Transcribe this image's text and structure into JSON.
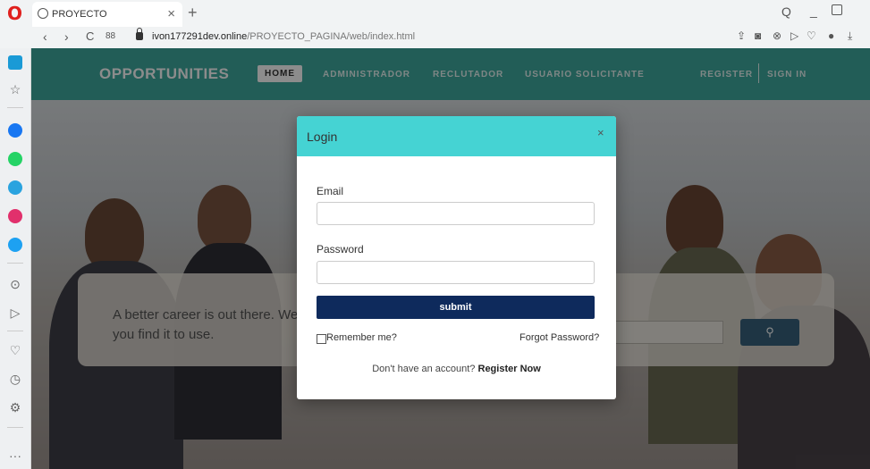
{
  "browser": {
    "tab": {
      "title": "PROYECTO",
      "close_glyph": "×"
    },
    "new_tab_glyph": "+",
    "url_host": "ivon177291dev.online",
    "url_path": "/PROYECTO_PAGINA/web/index.html",
    "nav": {
      "back": "‹",
      "forward": "›",
      "reload": "C",
      "speed_dial": "88"
    },
    "window_controls": {
      "search": "Q",
      "minimize": "_"
    },
    "address_icons": [
      "share-icon",
      "camera-icon",
      "block-icon",
      "play-icon",
      "heart-icon",
      "account-icon",
      "download-icon"
    ]
  },
  "sidebar": {
    "items": [
      "home-icon",
      "star-icon",
      "messenger-icon",
      "whatsapp-icon",
      "telegram-icon",
      "instagram-icon",
      "twitter-icon",
      "player-icon",
      "flow-icon",
      "heart-icon",
      "history-icon",
      "settings-icon",
      "more-icon"
    ],
    "colors": {
      "messenger": "#1877f2",
      "whatsapp": "#25d366",
      "telegram": "#2aa3df",
      "instagram": "#e1306c",
      "twitter": "#1da1f2",
      "home": "#1a9ad6"
    },
    "more_label": "···"
  },
  "site": {
    "brand": "OPPORTUNITIES",
    "nav": [
      "HOME",
      "ADMINISTRADOR",
      "RECLUTADOR",
      "USUARIO SOLICITANTE"
    ],
    "register": "REGISTER",
    "sign_in": "SIGN IN",
    "tagline": "A better career is out there. We'll help you find it to use.",
    "search_icon": "magnifier-icon",
    "colors": {
      "nav_bg": "#3ea99f",
      "search_btn": "#37617c"
    }
  },
  "modal": {
    "title": "Login",
    "close_glyph": "×",
    "email_label": "Email",
    "email_value": "",
    "password_label": "Password",
    "password_value": "",
    "submit_label": "submit",
    "remember_label": "Remember me?",
    "forgot_label": "Forgot Password?",
    "register_prompt": "Don't have an account?",
    "register_link": "Register Now",
    "colors": {
      "header": "#45d3d3",
      "submit": "#0e2a5c"
    }
  }
}
